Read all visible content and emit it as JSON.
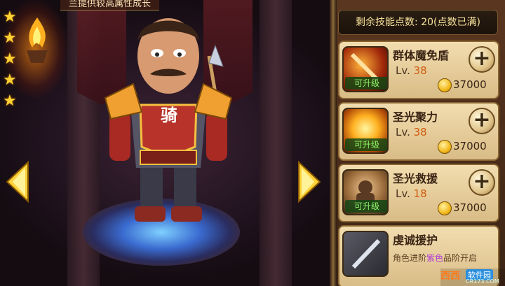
{
  "header": {
    "title": "兰提供较高属性成长"
  },
  "stars": {
    "count": 5
  },
  "panel": {
    "remaining_points": "剩余技能点数: 20(点数已满)",
    "skills": [
      {
        "name": "群体魔免盾",
        "level_label": "Lv.",
        "level": "38",
        "upgrade_tag": "可升级",
        "cost": "37000",
        "icon": "flaming-sword-icon"
      },
      {
        "name": "圣光聚力",
        "level_label": "Lv.",
        "level": "38",
        "upgrade_tag": "可升级",
        "cost": "37000",
        "icon": "holy-light-icon"
      },
      {
        "name": "圣光救援",
        "level_label": "Lv.",
        "level": "18",
        "upgrade_tag": "可升级",
        "cost": "37000",
        "icon": "warrior-rescue-icon"
      },
      {
        "name": "虔诚援护",
        "desc_prefix": "角色进阶",
        "desc_highlight": "紫色",
        "desc_suffix": "品阶开启",
        "icon": "silver-sword-icon"
      }
    ]
  },
  "hero": {
    "emblem": "骑"
  },
  "watermark": {
    "logo": "西西",
    "site": "软件园",
    "url": "CR173.COM"
  },
  "colors": {
    "star": "#ffd233",
    "upgrade_green": "#8ff06a",
    "level_orange": "#d05a10",
    "purple_rank": "#b23ad8"
  }
}
